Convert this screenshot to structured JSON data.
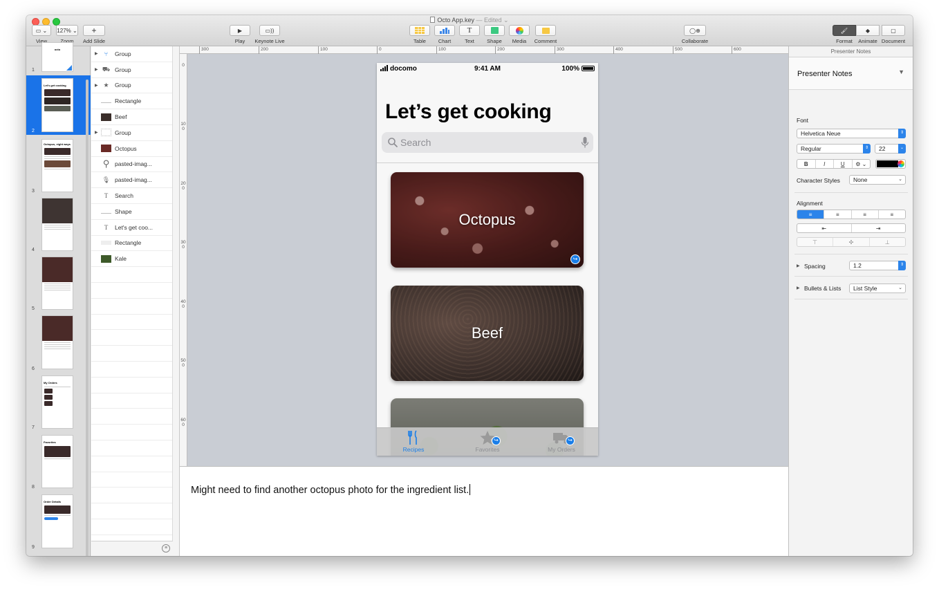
{
  "window": {
    "title": "Octo App.key",
    "edited": "— Edited"
  },
  "toolbar": {
    "view": "View",
    "zoom_value": "127%",
    "zoom": "Zoom",
    "add_slide": "Add Slide",
    "play": "Play",
    "keynote_live": "Keynote Live",
    "table": "Table",
    "chart": "Chart",
    "text": "Text",
    "shape": "Shape",
    "media": "Media",
    "comment": "Comment",
    "collaborate": "Collaborate",
    "format": "Format",
    "animate": "Animate",
    "document": "Document"
  },
  "slides": [
    {
      "num": "1",
      "title": "octo"
    },
    {
      "num": "2",
      "title": "Let's get cooking"
    },
    {
      "num": "3",
      "title": "Octopus, eight ways"
    },
    {
      "num": "4",
      "title": ""
    },
    {
      "num": "5",
      "title": ""
    },
    {
      "num": "6",
      "title": ""
    },
    {
      "num": "7",
      "title": "My Orders"
    },
    {
      "num": "8",
      "title": "Favorites"
    },
    {
      "num": "9",
      "title": "Order Details"
    }
  ],
  "layers": [
    {
      "name": "Group",
      "icon": "fork-knife-icon",
      "expandable": true
    },
    {
      "name": "Group",
      "icon": "truck-icon",
      "expandable": true
    },
    {
      "name": "Group",
      "icon": "star-icon",
      "expandable": true
    },
    {
      "name": "Rectangle",
      "icon": "line-icon",
      "expandable": false
    },
    {
      "name": "Beef",
      "icon": "image-icon",
      "expandable": false
    },
    {
      "name": "Group",
      "icon": "group-icon",
      "expandable": true
    },
    {
      "name": "Octopus",
      "icon": "image-icon",
      "expandable": false
    },
    {
      "name": "pasted-imag...",
      "icon": "search-icon",
      "expandable": false
    },
    {
      "name": "pasted-imag...",
      "icon": "mic-icon",
      "expandable": false
    },
    {
      "name": "Search",
      "icon": "text-icon",
      "expandable": false
    },
    {
      "name": "Shape",
      "icon": "line-icon",
      "expandable": false
    },
    {
      "name": "Let's get coo...",
      "icon": "text-icon",
      "expandable": false
    },
    {
      "name": "Rectangle",
      "icon": "line-icon",
      "expandable": false
    },
    {
      "name": "Kale",
      "icon": "image-icon",
      "expandable": false
    }
  ],
  "rulers": {
    "horizontal": [
      "300",
      "200",
      "100",
      "0",
      "100",
      "200",
      "300",
      "400",
      "500",
      "600"
    ],
    "vertical": [
      "0",
      "100",
      "200",
      "300",
      "400",
      "500",
      "600"
    ]
  },
  "phone": {
    "status": {
      "carrier": "docomo",
      "time": "9:41 AM",
      "battery": "100%"
    },
    "title": "Let’s get cooking",
    "search_placeholder": "Search",
    "cards": [
      {
        "label": "Octopus"
      },
      {
        "label": "Beef"
      },
      {
        "label": ""
      }
    ],
    "tabs": [
      {
        "label": "Recipes",
        "icon": "fork-knife-icon",
        "active": true
      },
      {
        "label": "Favorites",
        "icon": "star-icon",
        "active": false
      },
      {
        "label": "My Orders",
        "icon": "truck-icon",
        "active": false
      }
    ]
  },
  "notes": {
    "text": "Might need to find another octopus photo for the ingredient list."
  },
  "inspector": {
    "header": "Presenter Notes",
    "sub_title": "Presenter Notes",
    "font_label": "Font",
    "font_family": "Helvetica Neue",
    "font_style": "Regular",
    "font_size": "22",
    "bold": "B",
    "italic": "I",
    "underline": "U",
    "char_styles_label": "Character Styles",
    "char_styles_value": "None",
    "alignment_label": "Alignment",
    "spacing_label": "Spacing",
    "spacing_value": "1.2",
    "bullets_label": "Bullets & Lists",
    "bullets_value": "List Style",
    "text_color": "#000000"
  },
  "colors": {
    "accent": "#2c84ea",
    "selection": "#1a73e8",
    "canvas": "#c9cdd4"
  }
}
